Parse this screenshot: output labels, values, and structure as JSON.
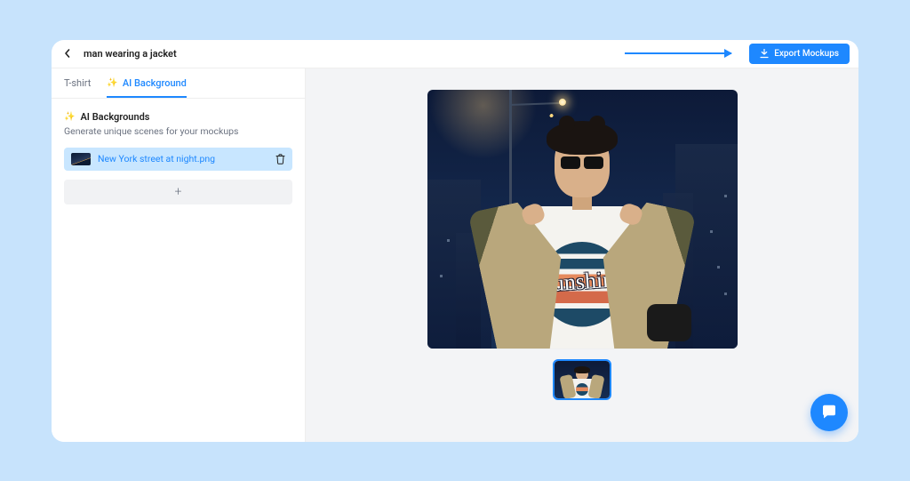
{
  "header": {
    "title": "man wearing a jacket",
    "export_label": "Export Mockups"
  },
  "tabs": {
    "tshirt": "T-shirt",
    "ai_bg": "AI Background"
  },
  "panel": {
    "title": "AI Backgrounds",
    "description": "Generate unique scenes for your mockups",
    "file_name": "New York street at night.png",
    "add_label": "+"
  },
  "preview": {
    "shirt_label": "Sunshine"
  }
}
